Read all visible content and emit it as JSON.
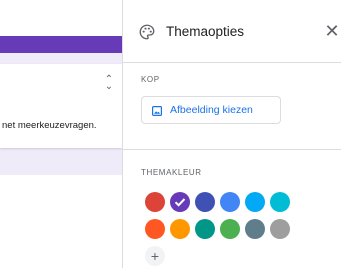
{
  "form": {
    "description_fragment": "net meerkeuzevragen."
  },
  "panel": {
    "title": "Themaopties",
    "header_section_label": "KOP",
    "choose_image_label": "Afbeelding kiezen",
    "theme_color_label": "THEMAKLEUR",
    "add_color_label": "+"
  },
  "theme_colors": {
    "row1": [
      "#db4437",
      "#673ab7",
      "#3f51b5",
      "#4285f4",
      "#03a9f4",
      "#00bcd4"
    ],
    "row2": [
      "#ff5722",
      "#ff9800",
      "#009688",
      "#4caf50",
      "#607d8b",
      "#9e9e9e"
    ],
    "selected": "#673ab7"
  },
  "colors": {
    "accent": "#673ab7",
    "link": "#1a73e8",
    "form_background": "#f0ebf8"
  }
}
